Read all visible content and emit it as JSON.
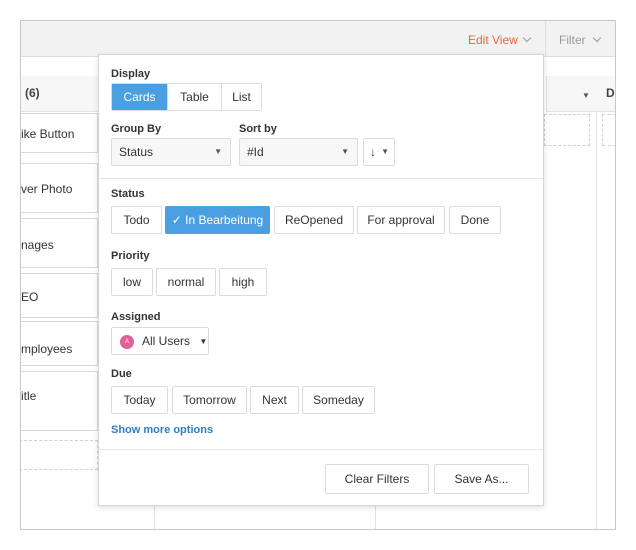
{
  "topbar": {
    "edit_view_label": "Edit View",
    "filter_label": "Filter"
  },
  "board": {
    "column1_header": "(6)",
    "column3_header": "D",
    "cards": [
      "ike Button",
      "ver Photo",
      "nages",
      "EO",
      "mployees",
      "itle"
    ]
  },
  "display": {
    "label": "Display",
    "options": [
      "Cards",
      "Table",
      "List"
    ],
    "selected": "Cards"
  },
  "group_by": {
    "label": "Group By",
    "value": "Status"
  },
  "sort_by": {
    "label": "Sort by",
    "value": "#Id",
    "direction": "↓"
  },
  "status": {
    "label": "Status",
    "options": [
      "Todo",
      "In Bearbeitung",
      "ReOpened",
      "For approval",
      "Done"
    ],
    "selected": "In Bearbeitung",
    "check": "✓"
  },
  "priority": {
    "label": "Priority",
    "options": [
      "low",
      "normal",
      "high"
    ]
  },
  "assigned": {
    "label": "Assigned",
    "value": "All Users",
    "avatar_initial": "A"
  },
  "due": {
    "label": "Due",
    "options": [
      "Today",
      "Tomorrow",
      "Next",
      "Someday"
    ]
  },
  "more_options_label": "Show more options",
  "footer": {
    "clear_label": "Clear Filters",
    "save_label": "Save As..."
  },
  "colors": {
    "accent": "#4a9fe0",
    "edit_view": "#e06a3e",
    "link": "#2b7fc4",
    "avatar": "#e0609a"
  }
}
